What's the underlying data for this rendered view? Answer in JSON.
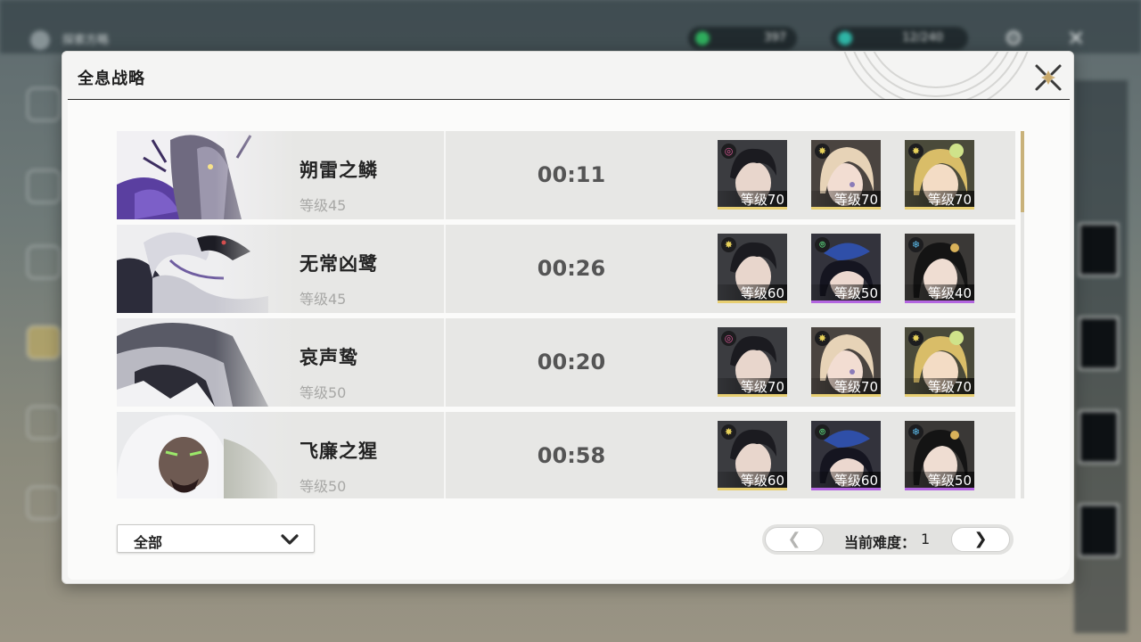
{
  "background": {
    "screen_title": "探索方略",
    "currencies": [
      {
        "value": "397",
        "color": "#2fae5d"
      },
      {
        "value": "12/240",
        "color": "#2fb6a7"
      }
    ]
  },
  "modal": {
    "title": "全息战略",
    "close_icon": "close-x-icon"
  },
  "rows": [
    {
      "boss_name": "朔雷之鳞",
      "boss_level": "等级45",
      "clear_time": "00:11",
      "team": [
        {
          "level": "等级70",
          "element": "havoc",
          "rarity_color": "#e8cf72"
        },
        {
          "level": "等级70",
          "element": "spectro",
          "rarity_color": "#e8cf72"
        },
        {
          "level": "等级70",
          "element": "spectro",
          "rarity_color": "#e8cf72"
        }
      ]
    },
    {
      "boss_name": "无常凶鹭",
      "boss_level": "等级45",
      "clear_time": "00:26",
      "team": [
        {
          "level": "等级60",
          "element": "spectro",
          "rarity_color": "#e8cf72"
        },
        {
          "level": "等级50",
          "element": "aero",
          "rarity_color": "#b366e0"
        },
        {
          "level": "等级40",
          "element": "glacio",
          "rarity_color": "#b366e0"
        }
      ]
    },
    {
      "boss_name": "哀声鸷",
      "boss_level": "等级50",
      "clear_time": "00:20",
      "team": [
        {
          "level": "等级70",
          "element": "havoc",
          "rarity_color": "#e8cf72"
        },
        {
          "level": "等级70",
          "element": "spectro",
          "rarity_color": "#e8cf72"
        },
        {
          "level": "等级70",
          "element": "spectro",
          "rarity_color": "#e8cf72"
        }
      ]
    },
    {
      "boss_name": "飞廉之猩",
      "boss_level": "等级50",
      "clear_time": "00:58",
      "team": [
        {
          "level": "等级60",
          "element": "spectro",
          "rarity_color": "#e8cf72"
        },
        {
          "level": "等级60",
          "element": "aero",
          "rarity_color": "#b366e0"
        },
        {
          "level": "等级50",
          "element": "glacio",
          "rarity_color": "#b366e0"
        }
      ]
    }
  ],
  "footer": {
    "filter": {
      "selected": "全部"
    },
    "pager": {
      "prev_label": "❮",
      "next_label": "❯",
      "label": "当前难度：",
      "value": "1"
    }
  },
  "colors": {
    "accent_gold": "#c9b27a",
    "rarity_gold": "#e8cf72",
    "rarity_purple": "#b366e0"
  }
}
